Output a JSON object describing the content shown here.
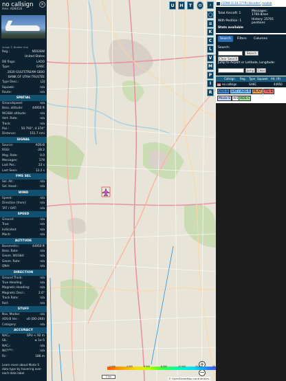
{
  "left": {
    "callsign": "no callsign",
    "hex_label": "Hex:",
    "hex": "A08418",
    "photo_credit": "Image © Brother Hue",
    "details": [
      {
        "k": "Reg.:",
        "v": "N5028W"
      },
      {
        "k": "",
        "v": "United States"
      },
      {
        "k": "DB flags:",
        "v": "LADD"
      },
      {
        "k": "Type:",
        "v": "GA6C"
      },
      {
        "k": "",
        "v": "2020 GULFSTREAM G600"
      },
      {
        "k": "",
        "v": "BANK OF UTAH TRUSTEE"
      },
      {
        "k": "Type Desc.:",
        "v": "L2J"
      },
      {
        "k": "Squawk:",
        "v": "n/a"
      },
      {
        "k": "Route:",
        "v": "n/a"
      }
    ],
    "sections": [
      {
        "title": "SPATIAL",
        "rows": [
          {
            "k": "Groundspeed:",
            "v": "n/a"
          },
          {
            "k": "Baro. altitude:",
            "v": "44950 ft"
          },
          {
            "k": "WGS84 altitude:",
            "v": "n/a"
          },
          {
            "k": "Vert. Rate:",
            "v": "n/a"
          },
          {
            "k": "Track:",
            "v": "n/a"
          },
          {
            "k": "Pos.:",
            "v": "50.793°, 4.374°"
          },
          {
            "k": "Distance:",
            "v": "151.7 nmi"
          }
        ]
      },
      {
        "title": "SIGNAL",
        "rows": [
          {
            "k": "Source:",
            "v": "ADS-B"
          },
          {
            "k": "RSSI:",
            "v": "-28.2"
          },
          {
            "k": "Msg. Rate:",
            "v": "0.0"
          },
          {
            "k": "Messages:",
            "v": "174"
          },
          {
            "k": "Last Pos.:",
            "v": "23 s"
          },
          {
            "k": "Last Seen:",
            "v": "12.2 s"
          }
        ]
      },
      {
        "title": "FMS SEL",
        "rows": [
          {
            "k": "Sel. Alt.:",
            "v": "n/a"
          },
          {
            "k": "Sel. Head.:",
            "v": "n/a"
          }
        ]
      },
      {
        "title": "WIND",
        "rows": [
          {
            "k": "Speed:",
            "v": "n/a"
          },
          {
            "k": "Direction (from):",
            "v": "n/a"
          },
          {
            "k": "TAT / OAT:",
            "v": "n/a"
          }
        ]
      },
      {
        "title": "SPEED",
        "rows": [
          {
            "k": "Ground:",
            "v": "n/a"
          },
          {
            "k": "True:",
            "v": "n/a"
          },
          {
            "k": "Indicated:",
            "v": "n/a"
          },
          {
            "k": "Mach:",
            "v": "n/a"
          }
        ]
      },
      {
        "title": "ALTITUDE",
        "rows": [
          {
            "k": "Barometric:",
            "v": "44950 ft"
          },
          {
            "k": "Baro. Rate:",
            "v": "n/a"
          },
          {
            "k": "Geom. WGS84:",
            "v": "n/a"
          },
          {
            "k": "Geom. Rate:",
            "v": "n/a"
          },
          {
            "k": "QNH:",
            "v": "n/a"
          }
        ]
      },
      {
        "title": "DIRECTION",
        "rows": [
          {
            "k": "Ground Track:",
            "v": "n/a"
          },
          {
            "k": "True Heading:",
            "v": "n/a"
          },
          {
            "k": "Magnetic Heading:",
            "v": "n/a"
          },
          {
            "k": "Magnetic Decl.:",
            "v": "2.6°"
          },
          {
            "k": "Track Rate:",
            "v": "n/a"
          },
          {
            "k": "Roll:",
            "v": "n/a"
          }
        ]
      },
      {
        "title": "STUFF",
        "rows": [
          {
            "k": "Nav. Modes:",
            "v": "n/a"
          },
          {
            "k": "ADS-B Ver.:",
            "v": "v0 (DO-260)"
          },
          {
            "k": "Category:",
            "v": "n/a"
          }
        ]
      },
      {
        "title": "ACCURACY",
        "rows": [
          {
            "k": "NACₚ:",
            "v": "EPU < 92 m"
          },
          {
            "k": "SIL:",
            "v": "≤ 1e-5"
          },
          {
            "k": "NACᵥ:",
            "v": "n/a"
          },
          {
            "k": "NICᴮᴬᴿᴼ:",
            "v": "n/a"
          },
          {
            "k": "Rc:",
            "v": "186 m"
          }
        ]
      }
    ],
    "learn_more": "Learn more about Mode S data type by hovering over each data label."
  },
  "map": {
    "top_buttons": [
      "U",
      "H",
      "T"
    ],
    "side_buttons": [
      "◯",
      "≡",
      "K",
      "M",
      "P",
      "I",
      "R"
    ],
    "side_extra": [
      "C",
      "L",
      "V"
    ],
    "zoom_in": "+",
    "zoom_out": "−",
    "scale_label": "2 km",
    "legend_ticks": [
      "2 000",
      "4 000",
      "6 000",
      "8 000",
      "10 000",
      "20 000",
      "30 000",
      "40 000+"
    ],
    "attribution": "© OpenStreetMap contributors."
  },
  "right": {
    "version_text": "v1098 (3.14.1779) decoder:",
    "readsb_link": "readsb",
    "stats": {
      "total_aircraft_label": "Total Aircraft: 1",
      "messages_label": "Messages:",
      "messages_value": "1760.8/sec",
      "with_position_label": "With Position: 1",
      "history_label": "History: 25701",
      "history_value": "positions",
      "stats_available": "Stats available"
    },
    "tabs": [
      "Search",
      "Filters",
      "Columns"
    ],
    "search": {
      "label": "Search:",
      "search_button": "Search",
      "clear_button": "Clear Search",
      "jump_label": "Jump to Airport or Latitude, Longitude:",
      "jump_button": "Jump",
      "clear2_button": "Clear"
    },
    "columns": [
      "",
      "Callsign",
      "Reg.",
      "Type",
      "Squawk",
      "Alt. (ft)"
    ],
    "aircraft_row": {
      "callsign": "no callsign",
      "type": "GA6C",
      "alt": "44950"
    },
    "badges": [
      {
        "label": "ADS-B",
        "color": "#4a90d9"
      },
      {
        "label": "UAT / ADS-R",
        "color": "#7cc6ff"
      },
      {
        "label": "MLAT",
        "color": "#f0a050"
      },
      {
        "label": "TIS-B",
        "color": "#ff6e6e"
      },
      {
        "label": "Mode-S",
        "color": "#c9d9ff"
      },
      {
        "label": "AIS",
        "color": "#ffffff"
      },
      {
        "label": "ADS-C",
        "color": "#9be29b"
      }
    ]
  }
}
